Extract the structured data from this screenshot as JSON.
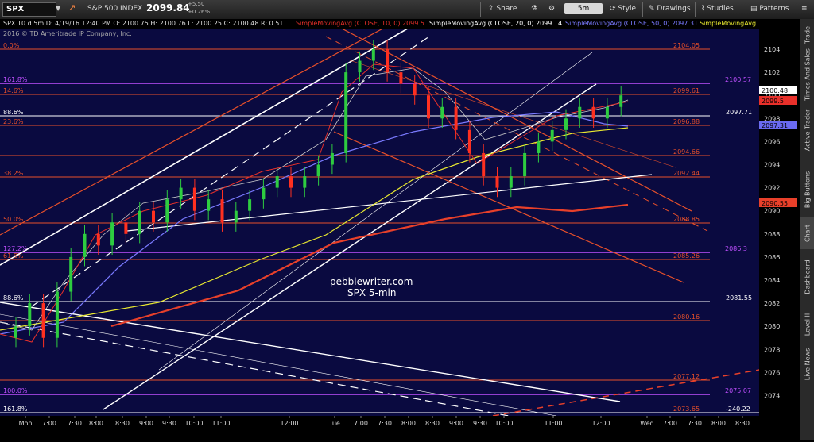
{
  "toolbar": {
    "symbol": "SPX",
    "description": "S&P 500 INDEX",
    "last": "2099.84",
    "change": "+5.50",
    "change_pct": "+0.26%",
    "share_label": "Share",
    "interval": "5m",
    "style_label": "Style",
    "drawings_label": "Drawings",
    "studies_label": "Studies",
    "patterns_label": "Patterns"
  },
  "infobar": {
    "ohlc": "SPX 10 d 5m  D: 4/19/16 12:40 PM  O: 2100.75  H: 2100.76  L: 2100.25  C: 2100.48  R: 0.51",
    "sma10": "SimpleMovingAvg (CLOSE, 10, 0)  2099.5",
    "sma20": "SimpleMovingAvg (CLOSE, 20, 0)  2099.14",
    "sma50": "SimpleMovingAvg (CLOSE, 50, 0)  2097.31",
    "sma_more": "SimpleMovingAvg...",
    "copyright": "2016 © TD Ameritrade IP Company, Inc."
  },
  "sidebar": [
    "Trade",
    "Times And Sales",
    "Active Trader",
    "Big Buttons",
    "Chart",
    "Dashboard",
    "Level II",
    "Live News"
  ],
  "active_sidebar": "Chart",
  "watermark": {
    "line1": "pebblewriter.com",
    "line2": "SPX 5-min"
  },
  "fib_levels": [
    {
      "pct": "0.0%",
      "price": "2104.05",
      "color": "#e8502a"
    },
    {
      "pct": "161.8%",
      "price": "2100.57",
      "color": "#c050ff"
    },
    {
      "pct": "14.6%",
      "price": "2099.61",
      "color": "#e8502a"
    },
    {
      "pct": "88.6%",
      "price": "2097.71",
      "color": "#ffffff"
    },
    {
      "pct": "23.6%",
      "price": "2096.88",
      "color": "#e8502a"
    },
    {
      "pct": "",
      "price": "2094.66",
      "color": "#e8502a"
    },
    {
      "pct": "38.2%",
      "price": "2092.44",
      "color": "#e8502a"
    },
    {
      "pct": "50.0%",
      "price": "2088.85",
      "color": "#e8502a"
    },
    {
      "pct": "127.2%",
      "price": "2086.3",
      "color": "#c050ff"
    },
    {
      "pct": "61.8%",
      "price": "2085.26",
      "color": "#e8502a"
    },
    {
      "pct": "88.6%",
      "price": "2081.55",
      "color": "#ffffff"
    },
    {
      "pct": "",
      "price": "2080.16",
      "color": "#e8502a"
    },
    {
      "pct": "",
      "price": "2077.12",
      "color": "#e8502a"
    },
    {
      "pct": "100.0%",
      "price": "2075.07",
      "color": "#c050ff"
    },
    {
      "pct": "",
      "price": "2073.65",
      "color": "#e8502a"
    },
    {
      "pct": "161.8%",
      "price": "-240.22",
      "color": "#ffffff"
    }
  ],
  "price_ticks": [
    "2104",
    "2102",
    "2100",
    "2098",
    "2096",
    "2094",
    "2092",
    "2090",
    "2088",
    "2086",
    "2084",
    "2082",
    "2080",
    "2078",
    "2076",
    "2074"
  ],
  "price_tags": [
    {
      "value": "2100.48",
      "bg": "#ffffff",
      "fg": "#000000"
    },
    {
      "value": "2099.5",
      "bg": "#e8302a",
      "fg": "#000000"
    },
    {
      "value": "2097.31",
      "bg": "#6a6af0",
      "fg": "#000000"
    },
    {
      "value": "2090.55",
      "bg": "#e8402a",
      "fg": "#000000"
    }
  ],
  "time_ticks": [
    "Mon",
    "7:00",
    "7:30",
    "8:00",
    "8:30",
    "9:00",
    "9:30",
    "10:00",
    "11:00",
    "12:00",
    "Tue",
    "7:00",
    "7:30",
    "8:00",
    "8:30",
    "9:00",
    "9:30",
    "10:00",
    "11:00",
    "12:00",
    "Wed",
    "7:00",
    "7:30",
    "8:00",
    "8:30"
  ]
}
